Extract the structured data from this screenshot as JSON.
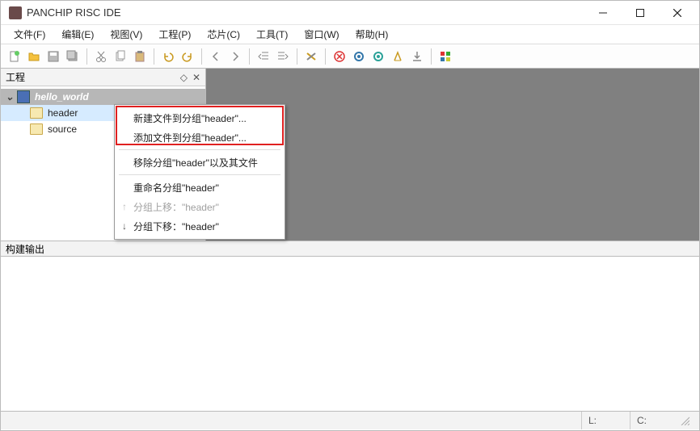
{
  "window": {
    "title": "PANCHIP RISC IDE"
  },
  "menubar": {
    "items": [
      {
        "label": "文件(F)"
      },
      {
        "label": "编辑(E)"
      },
      {
        "label": "视图(V)"
      },
      {
        "label": "工程(P)"
      },
      {
        "label": "芯片(C)"
      },
      {
        "label": "工具(T)"
      },
      {
        "label": "窗口(W)"
      },
      {
        "label": "帮助(H)"
      }
    ]
  },
  "toolbar": {
    "icons": [
      "new-file",
      "open-folder",
      "save",
      "save-all",
      "sep",
      "cut",
      "copy",
      "paste",
      "sep",
      "undo",
      "redo",
      "sep",
      "nav-back",
      "nav-forward",
      "sep",
      "outdent",
      "indent",
      "sep",
      "settings",
      "sep",
      "stop",
      "gear-blue",
      "gear-teal",
      "clean",
      "download",
      "sep",
      "terminal"
    ]
  },
  "project_panel": {
    "title": "工程",
    "project_name": "hello_world",
    "folders": [
      {
        "name": "header"
      },
      {
        "name": "source"
      }
    ]
  },
  "context_menu": {
    "items": [
      {
        "label": "新建文件到分组\"header\"...",
        "icon": "",
        "disabled": false
      },
      {
        "label": "添加文件到分组\"header\"...",
        "icon": "",
        "disabled": false
      },
      {
        "sep": true
      },
      {
        "label": "移除分组\"header\"以及其文件",
        "icon": "",
        "disabled": false
      },
      {
        "sep": true
      },
      {
        "label": "重命名分组\"header\"",
        "icon": "",
        "disabled": false
      },
      {
        "label": "分组上移：\"header\"",
        "icon": "↑",
        "disabled": true
      },
      {
        "label": "分组下移：\"header\"",
        "icon": "↓",
        "disabled": false
      }
    ]
  },
  "output": {
    "title": "构建输出"
  },
  "statusbar": {
    "line_label": "L:",
    "col_label": "C:"
  }
}
